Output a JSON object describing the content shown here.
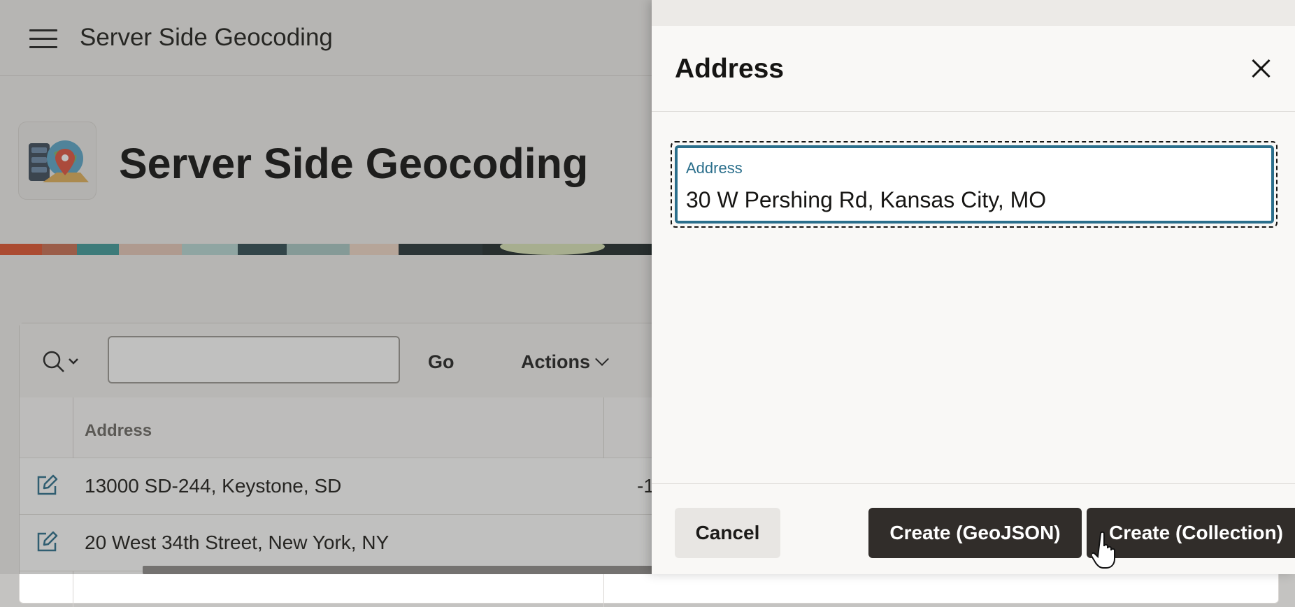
{
  "topbar": {
    "title": "Server Side Geocoding"
  },
  "hero": {
    "title": "Server Side Geocoding"
  },
  "report": {
    "go_label": "Go",
    "actions_label": "Actions",
    "columns": [
      "Address"
    ],
    "rows": [
      {
        "address": "13000 SD-244, Keystone, SD",
        "value": "-1"
      },
      {
        "address": "20 West 34th Street, New York, NY",
        "value": ""
      }
    ]
  },
  "dialog": {
    "title": "Address",
    "field_label": "Address",
    "field_value": "30 W Pershing Rd, Kansas City, MO",
    "cancel_label": "Cancel",
    "create_geojson_label": "Create (GeoJSON)",
    "create_collection_label": "Create (Collection)"
  },
  "colors": {
    "accent": "#2b6f8c",
    "primary_button": "#312d2a",
    "edit_icon": "#2b6f8c"
  },
  "icons": [
    "menu-icon",
    "app-logo-icon",
    "search-icon",
    "chevron-down-icon",
    "edit-icon",
    "close-icon",
    "pointer-cursor-icon"
  ]
}
